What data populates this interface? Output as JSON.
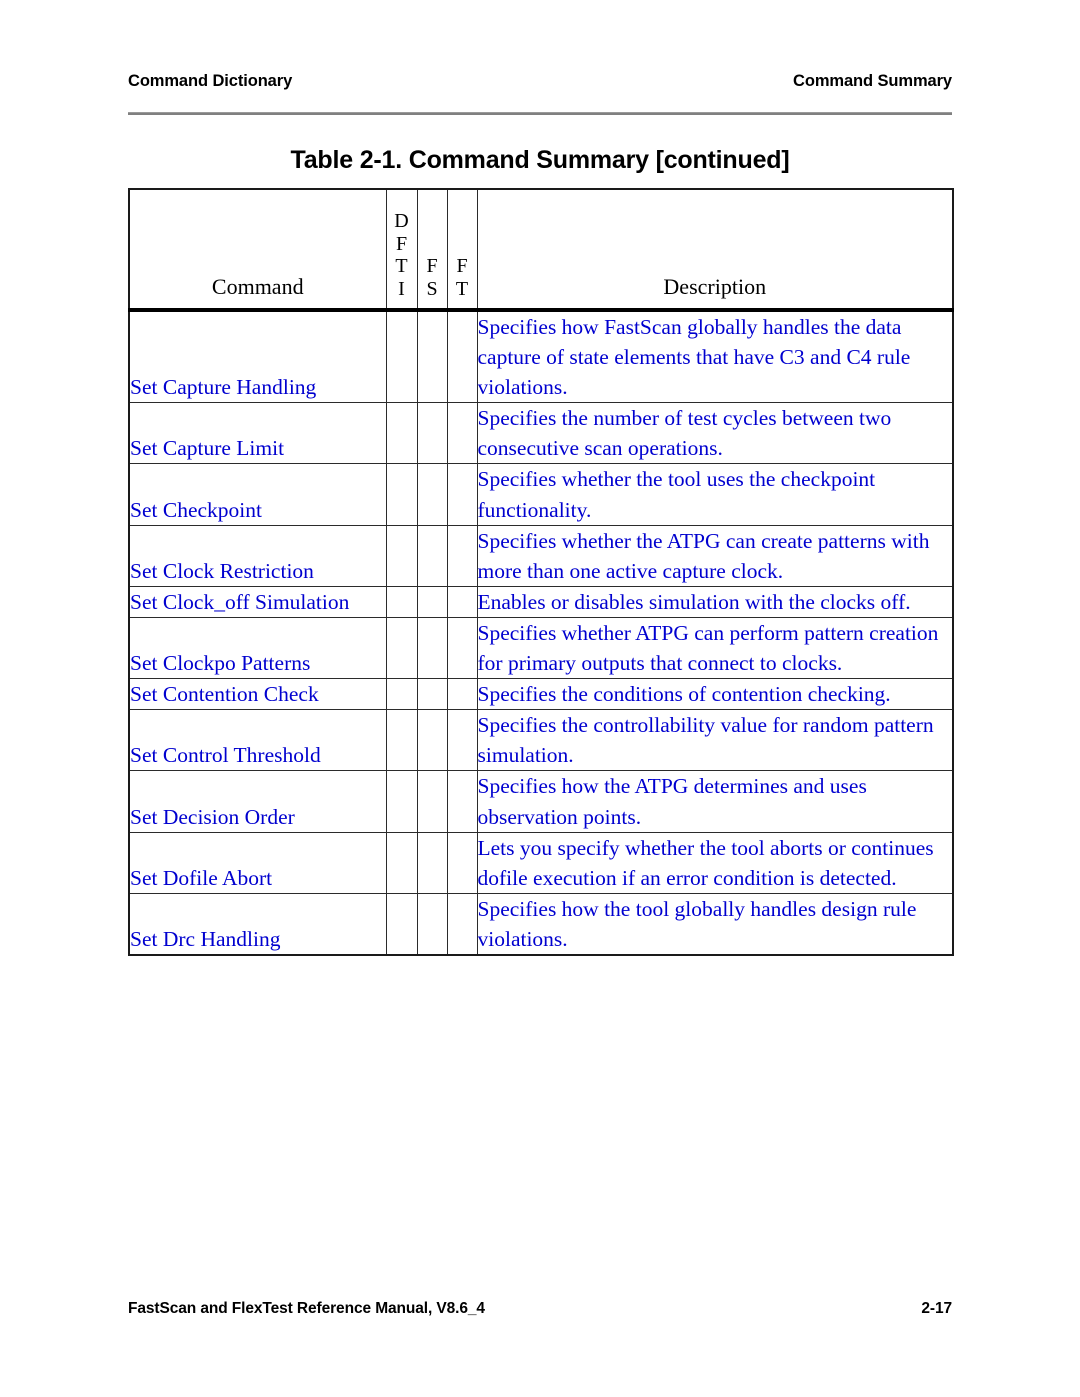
{
  "running_head": {
    "left": "Command Dictionary",
    "right": "Command Summary"
  },
  "table_title": "Table 2-1. Command Summary [continued]",
  "table": {
    "headers": {
      "command": "Command",
      "dfti": [
        "D",
        "F",
        "T",
        "I"
      ],
      "fs": [
        "F",
        "S"
      ],
      "ft": [
        "F",
        "T"
      ],
      "description": "Description"
    },
    "rows": [
      {
        "command": "Set Capture Handling",
        "dfti": "",
        "fs": "",
        "ft": "",
        "description": "Specifies how FastScan globally handles the data capture of state elements that have C3 and C4 rule violations."
      },
      {
        "command": "Set Capture Limit",
        "dfti": "",
        "fs": "",
        "ft": "",
        "description": "Specifies the number of test cycles between two consecutive scan operations."
      },
      {
        "command": "Set Checkpoint",
        "dfti": "",
        "fs": "",
        "ft": "",
        "description": "Specifies whether the tool uses the checkpoint functionality."
      },
      {
        "command": "Set Clock Restriction",
        "dfti": "",
        "fs": "",
        "ft": "",
        "description": "Specifies whether the ATPG can create patterns with more than one active capture clock."
      },
      {
        "command": "Set Clock_off Simulation",
        "dfti": "",
        "fs": "",
        "ft": "",
        "description": "Enables or disables simulation with the clocks off."
      },
      {
        "command": "Set Clockpo Patterns",
        "dfti": "",
        "fs": "",
        "ft": "",
        "description": "Specifies whether ATPG can perform pattern creation for primary outputs that connect to clocks."
      },
      {
        "command": "Set Contention Check",
        "dfti": "",
        "fs": "",
        "ft": "",
        "description": "Specifies the conditions of contention checking."
      },
      {
        "command": "Set Control Threshold",
        "dfti": "",
        "fs": "",
        "ft": "",
        "description": "Specifies the controllability value for random pattern simulation."
      },
      {
        "command": "Set Decision Order",
        "dfti": "",
        "fs": "",
        "ft": "",
        "description": "Specifies how the ATPG determines and uses observation points."
      },
      {
        "command": "Set Dofile Abort",
        "dfti": "",
        "fs": "",
        "ft": "",
        "description": "Lets you specify whether the tool aborts or continues dofile execution if an error condition is detected."
      },
      {
        "command": "Set Drc Handling",
        "dfti": "",
        "fs": "",
        "ft": "",
        "description": "Specifies how the tool globally handles design rule violations."
      }
    ]
  },
  "footer": {
    "manual": "FastScan and FlexTest Reference Manual, V8.6_4",
    "page_number": "2-17"
  },
  "colors": {
    "link_blue": "#0000cf",
    "rule_gray": "#808080",
    "text_black": "#000000"
  }
}
